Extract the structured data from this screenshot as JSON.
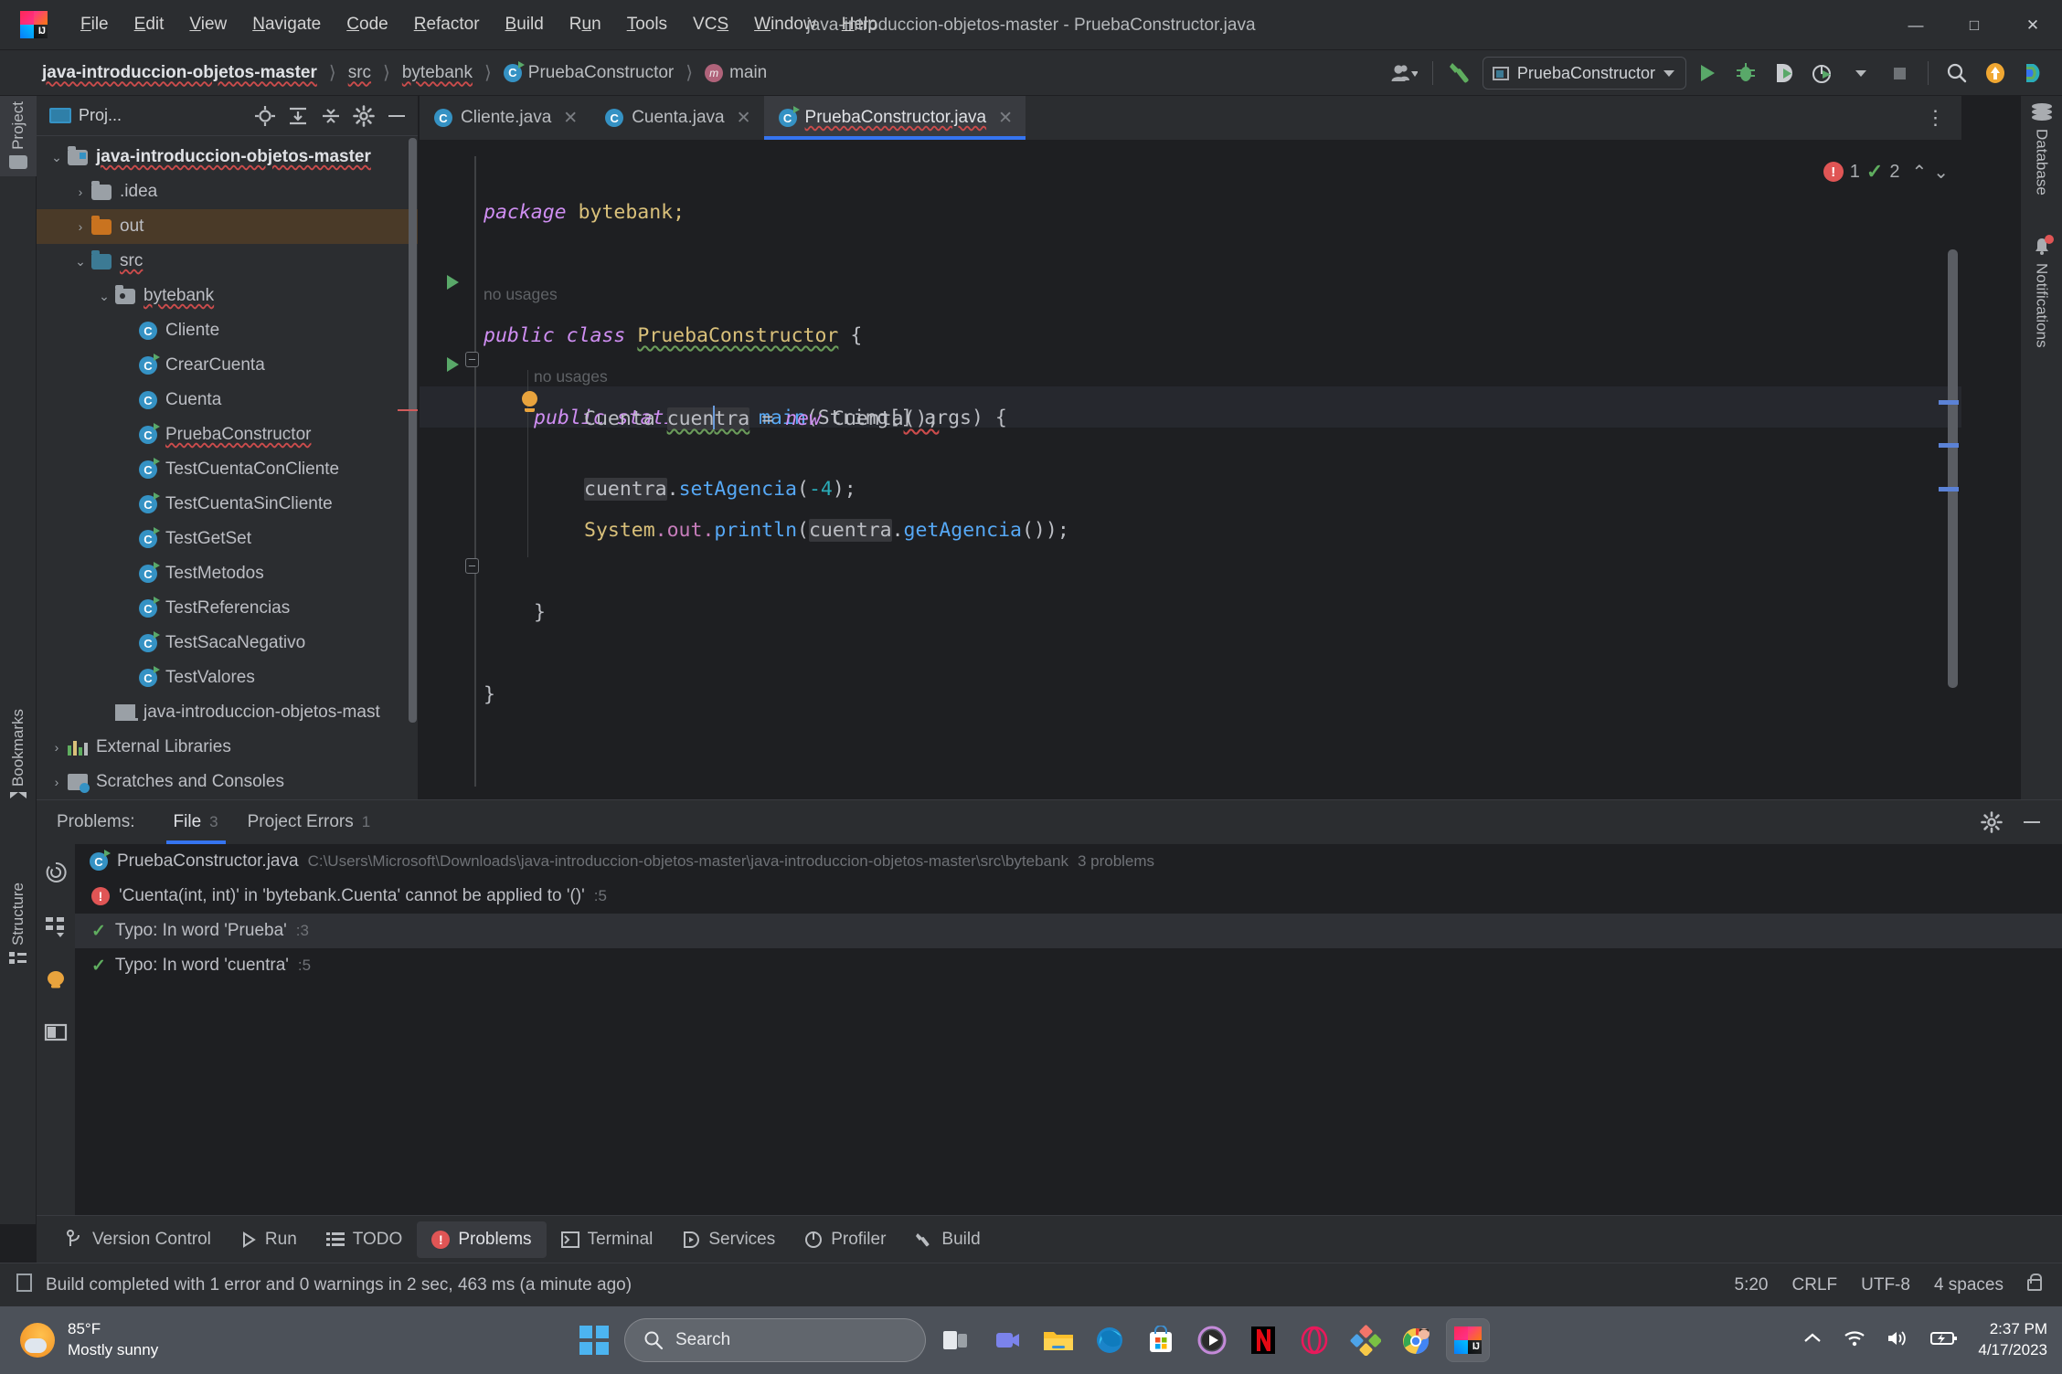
{
  "window": {
    "title": "java-introduccion-objetos-master - PruebaConstructor.java",
    "minimize": "—",
    "maximize": "☐",
    "close": "✕"
  },
  "menubar": {
    "items": [
      "File",
      "Edit",
      "View",
      "Navigate",
      "Code",
      "Refactor",
      "Build",
      "Run",
      "Tools",
      "VCS",
      "Window",
      "Help"
    ]
  },
  "breadcrumbs": [
    {
      "label": "java-introduccion-objetos-master",
      "icon": "none"
    },
    {
      "label": "src",
      "icon": "none"
    },
    {
      "label": "bytebank",
      "icon": "none"
    },
    {
      "label": "PruebaConstructor",
      "icon": "class-run-icon"
    },
    {
      "label": "main",
      "icon": "method-icon"
    }
  ],
  "toolbar": {
    "account_icon": "user-account-icon",
    "build_icon": "hammer-build-icon",
    "run_config": "PruebaConstructor",
    "run_icon": "run-icon",
    "debug_icon": "debug-icon",
    "run_coverage_icon": "run-with-coverage-icon",
    "profile_icon": "profiler-icon",
    "stop_icon": "stop-icon",
    "search_icon": "search-everywhere-icon",
    "update_icon": "update-project-icon",
    "ai_icon": "ai-assistant-icon"
  },
  "left_strip": {
    "project": "Project",
    "bookmarks": "Bookmarks",
    "structure": "Structure"
  },
  "right_strip": {
    "database": "Database",
    "notifications": "Notifications"
  },
  "project_panel": {
    "title": "Proj...",
    "header_icons": [
      "locate-icon",
      "expand-all-icon",
      "collapse-all-icon",
      "settings-gear-icon",
      "hide-icon"
    ],
    "tree": [
      {
        "label": "java-introduccion-objetos-master",
        "depth": 0,
        "chevron": "⌄",
        "icon": "module-folder",
        "bold": true,
        "squiggle": true,
        "state": "normal"
      },
      {
        "label": ".idea",
        "depth": 1,
        "chevron": "›",
        "icon": "folder-grey",
        "bold": false,
        "squiggle": false,
        "state": "normal"
      },
      {
        "label": "out",
        "depth": 1,
        "chevron": "›",
        "icon": "folder-orange",
        "bold": false,
        "squiggle": false,
        "state": "highlight"
      },
      {
        "label": "src",
        "depth": 1,
        "chevron": "⌄",
        "icon": "folder-blue",
        "bold": false,
        "squiggle": true,
        "state": "normal"
      },
      {
        "label": "bytebank",
        "depth": 2,
        "chevron": "⌄",
        "icon": "package",
        "bold": false,
        "squiggle": true,
        "state": "normal"
      },
      {
        "label": "Cliente",
        "depth": 3,
        "chevron": "",
        "icon": "class",
        "bold": false,
        "squiggle": false,
        "state": "normal"
      },
      {
        "label": "CrearCuenta",
        "depth": 3,
        "chevron": "",
        "icon": "class-run",
        "bold": false,
        "squiggle": false,
        "state": "normal"
      },
      {
        "label": "Cuenta",
        "depth": 3,
        "chevron": "",
        "icon": "class",
        "bold": false,
        "squiggle": false,
        "state": "normal"
      },
      {
        "label": "PruebaConstructor",
        "depth": 3,
        "chevron": "",
        "icon": "class-run",
        "bold": false,
        "squiggle": true,
        "state": "normal"
      },
      {
        "label": "TestCuentaConCliente",
        "depth": 3,
        "chevron": "",
        "icon": "class-run",
        "bold": false,
        "squiggle": false,
        "state": "normal"
      },
      {
        "label": "TestCuentaSinCliente",
        "depth": 3,
        "chevron": "",
        "icon": "class-run",
        "bold": false,
        "squiggle": false,
        "state": "normal"
      },
      {
        "label": "TestGetSet",
        "depth": 3,
        "chevron": "",
        "icon": "class-run",
        "bold": false,
        "squiggle": false,
        "state": "normal"
      },
      {
        "label": "TestMetodos",
        "depth": 3,
        "chevron": "",
        "icon": "class-run",
        "bold": false,
        "squiggle": false,
        "state": "normal"
      },
      {
        "label": "TestReferencias",
        "depth": 3,
        "chevron": "",
        "icon": "class-run",
        "bold": false,
        "squiggle": false,
        "state": "normal"
      },
      {
        "label": "TestSacaNegativo",
        "depth": 3,
        "chevron": "",
        "icon": "class-run",
        "bold": false,
        "squiggle": false,
        "state": "normal"
      },
      {
        "label": "TestValores",
        "depth": 3,
        "chevron": "",
        "icon": "class-run",
        "bold": false,
        "squiggle": false,
        "state": "normal"
      },
      {
        "label": "java-introduccion-objetos-mast",
        "depth": 2,
        "chevron": "",
        "icon": "jar-module",
        "bold": false,
        "squiggle": false,
        "state": "normal"
      },
      {
        "label": "External Libraries",
        "depth": 0,
        "chevron": "›",
        "icon": "libraries",
        "bold": false,
        "squiggle": false,
        "state": "normal"
      },
      {
        "label": "Scratches and Consoles",
        "depth": 0,
        "chevron": "›",
        "icon": "scratches",
        "bold": false,
        "squiggle": false,
        "state": "normal"
      }
    ]
  },
  "editor": {
    "tabs": [
      {
        "label": "Cliente.java",
        "active": false,
        "icon": "class-icon",
        "close": "✕"
      },
      {
        "label": "Cuenta.java",
        "active": false,
        "icon": "class-icon",
        "close": "✕"
      },
      {
        "label": "PruebaConstructor.java",
        "active": true,
        "icon": "class-run-icon",
        "close": "✕"
      }
    ],
    "more_tabs_icon": "more-options-icon",
    "inspections": {
      "error_count": "1",
      "ok_count": "2",
      "prev_icon": "⌃",
      "next_icon": "⌄"
    },
    "hints": {
      "class_usage": "no usages",
      "method_usage": "no usages"
    },
    "code": {
      "line1_kw": "package",
      "line1_pkg": "bytebank;",
      "line3_public": "public",
      "line3_class": "class",
      "line3_name": "PruebaConstructor",
      "line3_brace": "{",
      "line5_public": "public",
      "line5_static": "static",
      "line5_void": "void",
      "line5_main": "main",
      "line5_args": "(String[] args) {",
      "line6_type": "Cuenta",
      "line6_var_a": "cuen",
      "line6_var_b": "tra",
      "line6_eq": " = ",
      "line6_new": "new",
      "line6_ctor": " Cuenta",
      "line6_tail": "();",
      "line7_var": "cuentra",
      "line7_dot": ".",
      "line7_mth": "setAgencia",
      "line7_open": "(",
      "line7_num": "-4",
      "line7_close": ");",
      "line8_sys": "System",
      "line8_out": ".out.",
      "line8_println": "println",
      "line8_open": "(",
      "line8_var": "cuentra",
      "line8_dot": ".",
      "line8_get": "getAgencia",
      "line8_tail": "());",
      "line10_close": "}",
      "line12_close": "}"
    }
  },
  "problems": {
    "label": "Problems:",
    "tabs": [
      {
        "label": "File",
        "count": "3",
        "active": true
      },
      {
        "label": "Project Errors",
        "count": "1",
        "active": false
      }
    ],
    "header_icons": [
      "settings-gear-icon",
      "hide-panel-icon"
    ],
    "side_icons": [
      "inspection-icon",
      "group-by-icon",
      "highlight-icon",
      "preview-icon"
    ],
    "file_row": {
      "name": "PruebaConstructor.java",
      "path": "C:\\Users\\Microsoft\\Downloads\\java-introduccion-objetos-master\\java-introduccion-objetos-master\\src\\bytebank",
      "count": "3 problems"
    },
    "items": [
      {
        "icon": "error-icon",
        "text": "'Cuenta(int, int)' in 'bytebank.Cuenta' cannot be applied to '()'",
        "loc": ":5",
        "selected": false
      },
      {
        "icon": "typo-icon",
        "text": "Typo: In word 'Prueba'",
        "loc": ":3",
        "selected": true
      },
      {
        "icon": "typo-icon",
        "text": "Typo: In word 'cuentra'",
        "loc": ":5",
        "selected": false
      }
    ]
  },
  "bottom_bar": {
    "tabs": [
      {
        "label": "Version Control",
        "icon": "branch-icon",
        "active": false
      },
      {
        "label": "Run",
        "icon": "run-icon",
        "active": false
      },
      {
        "label": "TODO",
        "icon": "todo-list-icon",
        "active": false
      },
      {
        "label": "Problems",
        "icon": "error-icon",
        "active": true
      },
      {
        "label": "Terminal",
        "icon": "terminal-icon",
        "active": false
      },
      {
        "label": "Services",
        "icon": "services-icon",
        "active": false
      },
      {
        "label": "Profiler",
        "icon": "profiler-icon",
        "active": false
      },
      {
        "label": "Build",
        "icon": "hammer-build-icon",
        "active": false
      }
    ]
  },
  "status_bar": {
    "icon": "build-status-icon",
    "message": "Build completed with 1 error and 0 warnings in 2 sec, 463 ms (a minute ago)",
    "caret_position": "5:20",
    "line_separator": "CRLF",
    "encoding": "UTF-8",
    "indent": "4 spaces",
    "lock_icon": "unlocked-icon"
  },
  "taskbar": {
    "weather": {
      "temp": "85°F",
      "condition": "Mostly sunny",
      "icon": "partly-sunny-icon"
    },
    "start_icon": "windows-start-icon",
    "search_placeholder": "Search",
    "search_icon": "search-icon",
    "pinned": [
      {
        "name": "task-view-icon"
      },
      {
        "name": "teams-icon"
      },
      {
        "name": "file-explorer-icon"
      },
      {
        "name": "microsoft-edge-icon"
      },
      {
        "name": "microsoft-store-icon"
      },
      {
        "name": "media-player-icon"
      },
      {
        "name": "netflix-icon"
      },
      {
        "name": "opera-icon"
      },
      {
        "name": "photos-icon"
      },
      {
        "name": "google-chrome-icon"
      },
      {
        "name": "intellij-idea-icon"
      }
    ],
    "tray": {
      "chevron_icon": "show-hidden-icons",
      "wifi_icon": "wifi-icon",
      "volume_icon": "volume-icon",
      "battery_icon": "battery-charging-icon",
      "time": "2:37 PM",
      "date": "4/17/2023"
    }
  }
}
